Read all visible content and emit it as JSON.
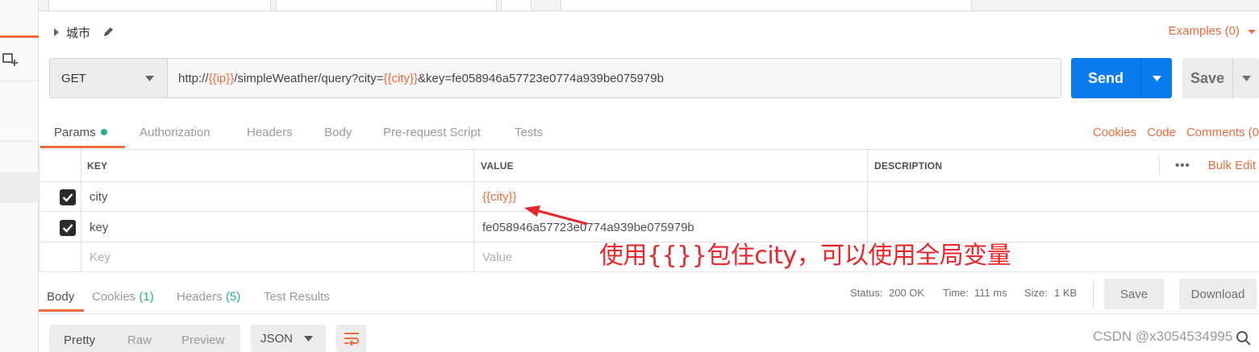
{
  "request": {
    "name": "城市",
    "examples_label": "Examples (0)",
    "method": "GET",
    "url_parts": [
      {
        "text": "http://",
        "var": false
      },
      {
        "text": "{{ip}}",
        "var": true
      },
      {
        "text": "/simpleWeather/query?city=",
        "var": false
      },
      {
        "text": "{{city}}",
        "var": true
      },
      {
        "text": "&key=fe058946a57723e0774a939be075979b",
        "var": false
      }
    ],
    "send_label": "Send",
    "save_label": "Save"
  },
  "request_tabs": {
    "items": [
      "Params",
      "Authorization",
      "Headers",
      "Body",
      "Pre-request Script",
      "Tests"
    ],
    "active": "Params",
    "right_links": [
      "Cookies",
      "Code",
      "Comments (0"
    ]
  },
  "params_table": {
    "headers": {
      "key": "KEY",
      "value": "VALUE",
      "description": "DESCRIPTION"
    },
    "more_label": "•••",
    "bulk_edit_label": "Bulk Edit",
    "rows": [
      {
        "checked": true,
        "key": "city",
        "value": "{{city}}"
      },
      {
        "checked": true,
        "key": "key",
        "value": "fe058946a57723e0774a939be075979b"
      }
    ],
    "placeholder": {
      "key": "Key",
      "value": "Value"
    }
  },
  "annotation": {
    "text": "使用{{}}包住city，可以使用全局变量",
    "color": "#e8262c"
  },
  "response": {
    "tabs": [
      "Body",
      "Cookies",
      "Headers",
      "Test Results"
    ],
    "cookies_count": "(1)",
    "headers_count": "(5)",
    "active": "Body",
    "status_label": "Status:",
    "status_value": "200 OK",
    "time_label": "Time:",
    "time_value": "111 ms",
    "size_label": "Size:",
    "size_value": "1 KB",
    "save_label": "Save",
    "download_label": "Download",
    "formats": [
      "Pretty",
      "Raw",
      "Preview"
    ],
    "active_format": "Pretty",
    "language": "JSON"
  },
  "watermark": "CSDN @x3054534995",
  "colors": {
    "accent": "#f26b3a",
    "send_blue": "#097bed",
    "success_green": "#26b47f",
    "annotation_red": "#e8262c"
  },
  "icons": [
    "new-request-icon",
    "edit-icon",
    "chevron-down-icon",
    "more-icon",
    "wrap-lines-icon",
    "checkbox-checked-icon",
    "search-icon"
  ]
}
